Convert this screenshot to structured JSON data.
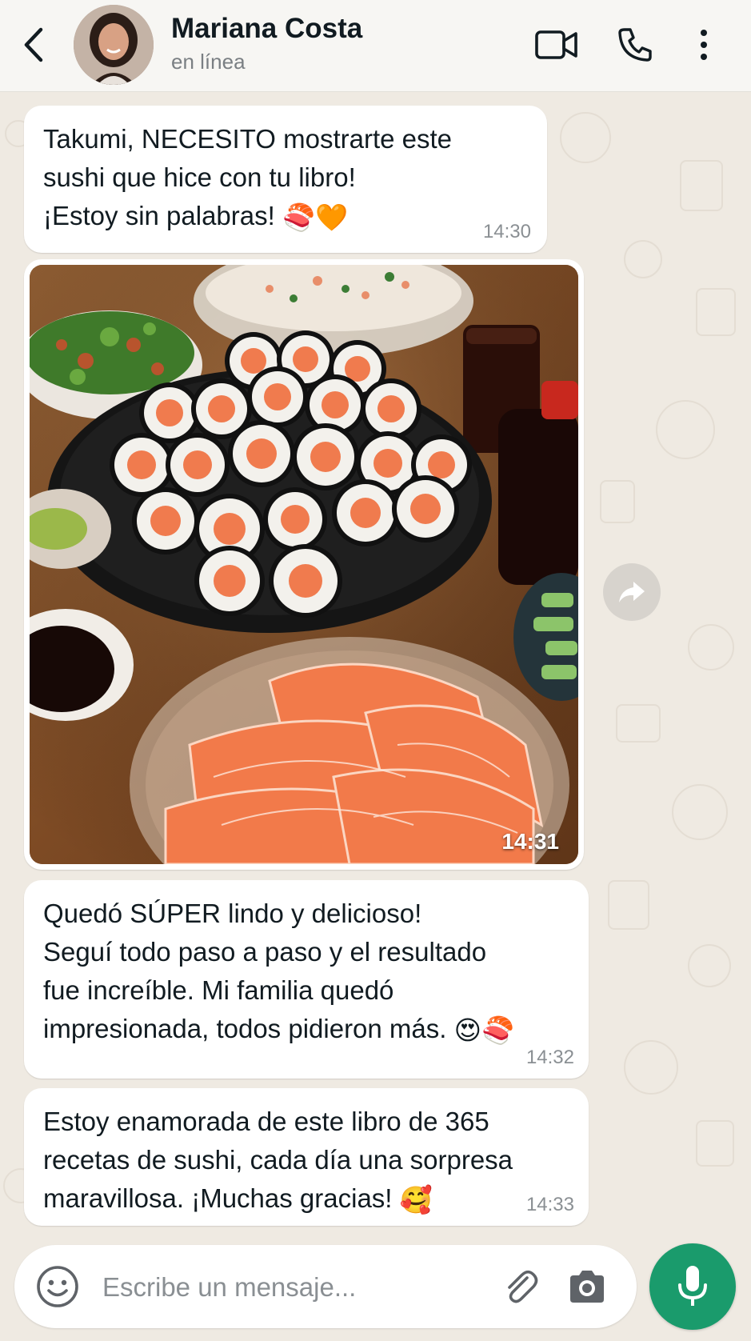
{
  "header": {
    "contact_name": "Mariana Costa",
    "status": "en línea",
    "icons": [
      "back-arrow-icon",
      "video-call-icon",
      "voice-call-icon",
      "more-options-icon"
    ]
  },
  "messages": [
    {
      "type": "text",
      "text": "Takumi, NECESITO mostrarte este\nsushi que hice con tu libro!\n¡Estoy sin palabras!",
      "emojis": "🍣🧡",
      "time": "14:30"
    },
    {
      "type": "image",
      "image_description_icon": "sushi-photo",
      "time": "14:31"
    },
    {
      "type": "text",
      "text": "Quedó SÚPER lindo y delicioso!\nSeguí todo paso a paso y el resultado\nfue increíble. Mi familia quedó\nimpresionada, todos pidieron más.",
      "emojis": "😍🍣",
      "time": "14:32"
    },
    {
      "type": "text",
      "text": "Estoy enamorada de este libro de 365\nrecetas de sushi, cada día una sorpresa\nmaravillosa. ¡Muchas gracias!",
      "emojis": "🥰",
      "time": "14:33"
    }
  ],
  "composer": {
    "placeholder": "Escribe un mensaje...",
    "value": ""
  },
  "colors": {
    "wallpaper": "#efeae2",
    "bubble": "#ffffff",
    "mic_button": "#1a9b6c"
  }
}
